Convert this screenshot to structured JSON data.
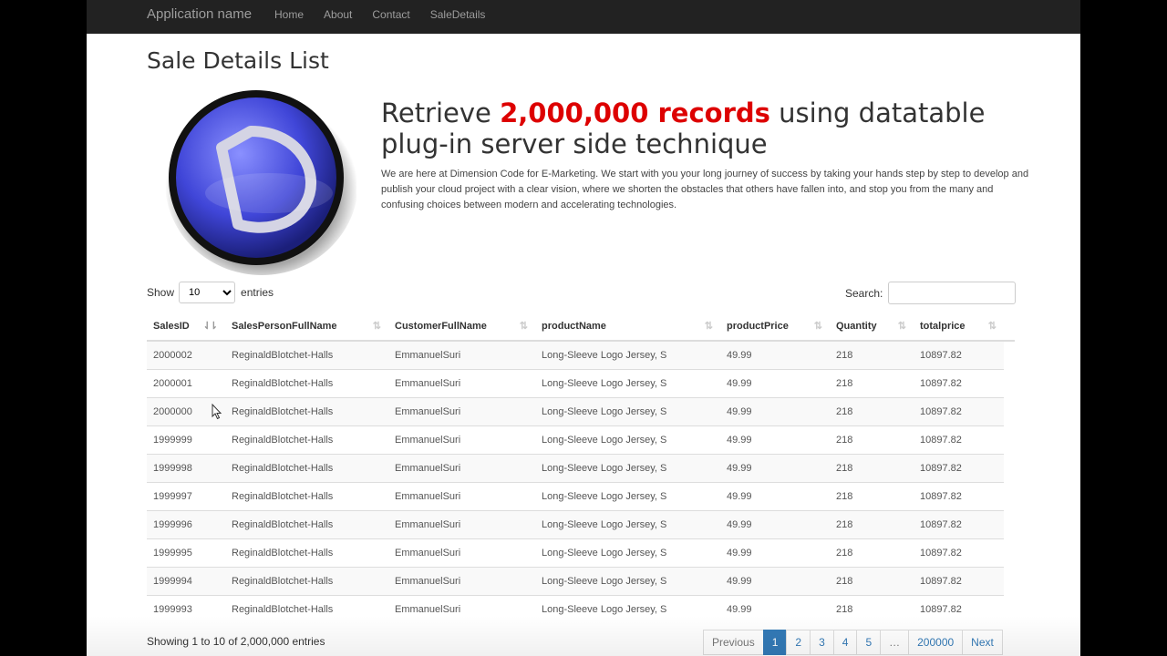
{
  "navbar": {
    "brand": "Application name",
    "links": [
      "Home",
      "About",
      "Contact",
      "SaleDetails"
    ]
  },
  "page_title": "Sale Details List",
  "hero": {
    "heading_before": "Retrieve ",
    "heading_accent": "2,000,000 records",
    "heading_after": " using datatable plug-in server side technique",
    "description": "We are here at Dimension Code for E-Marketing. We start with you your long journey of success by taking your hands step by step to develop and publish your cloud project with a clear vision, where we shorten the obstacles that others have fallen into, and stop you from the many and confusing choices between modern and accelerating technologies."
  },
  "controls": {
    "show_label": "Show",
    "entries_value": "10",
    "entries_label": "entries",
    "search_label": "Search:"
  },
  "table": {
    "columns": [
      "SalesID",
      "SalesPersonFullName",
      "CustomerFullName",
      "productName",
      "productPrice",
      "Quantity",
      "totalprice"
    ],
    "rows": [
      [
        "2000002",
        "ReginaldBlotchet-Halls",
        "EmmanuelSuri",
        "Long-Sleeve Logo Jersey, S",
        "49.99",
        "218",
        "10897.82"
      ],
      [
        "2000001",
        "ReginaldBlotchet-Halls",
        "EmmanuelSuri",
        "Long-Sleeve Logo Jersey, S",
        "49.99",
        "218",
        "10897.82"
      ],
      [
        "2000000",
        "ReginaldBlotchet-Halls",
        "EmmanuelSuri",
        "Long-Sleeve Logo Jersey, S",
        "49.99",
        "218",
        "10897.82"
      ],
      [
        "1999999",
        "ReginaldBlotchet-Halls",
        "EmmanuelSuri",
        "Long-Sleeve Logo Jersey, S",
        "49.99",
        "218",
        "10897.82"
      ],
      [
        "1999998",
        "ReginaldBlotchet-Halls",
        "EmmanuelSuri",
        "Long-Sleeve Logo Jersey, S",
        "49.99",
        "218",
        "10897.82"
      ],
      [
        "1999997",
        "ReginaldBlotchet-Halls",
        "EmmanuelSuri",
        "Long-Sleeve Logo Jersey, S",
        "49.99",
        "218",
        "10897.82"
      ],
      [
        "1999996",
        "ReginaldBlotchet-Halls",
        "EmmanuelSuri",
        "Long-Sleeve Logo Jersey, S",
        "49.99",
        "218",
        "10897.82"
      ],
      [
        "1999995",
        "ReginaldBlotchet-Halls",
        "EmmanuelSuri",
        "Long-Sleeve Logo Jersey, S",
        "49.99",
        "218",
        "10897.82"
      ],
      [
        "1999994",
        "ReginaldBlotchet-Halls",
        "EmmanuelSuri",
        "Long-Sleeve Logo Jersey, S",
        "49.99",
        "218",
        "10897.82"
      ],
      [
        "1999993",
        "ReginaldBlotchet-Halls",
        "EmmanuelSuri",
        "Long-Sleeve Logo Jersey, S",
        "49.99",
        "218",
        "10897.82"
      ]
    ]
  },
  "footer": {
    "info": "Showing 1 to 10 of 2,000,000 entries",
    "pagination": [
      "Previous",
      "1",
      "2",
      "3",
      "4",
      "5",
      "…",
      "200000",
      "Next"
    ],
    "active_page": "1"
  },
  "colors": {
    "navbar_bg": "#222222",
    "accent_red": "#dd0000",
    "link_blue": "#337ab7"
  }
}
